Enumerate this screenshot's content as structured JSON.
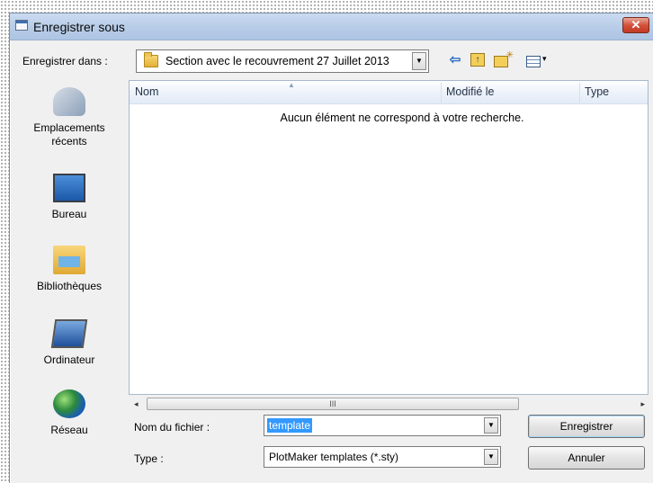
{
  "window": {
    "title": "Enregistrer sous",
    "close_glyph": "✕"
  },
  "toolbar": {
    "save_in_label": "Enregistrer dans :",
    "location": "Section avec le recouvrement 27 Juillet 2013",
    "dropdown_glyph": "▼",
    "back_glyph": "⇦",
    "up_glyph": "↑",
    "view_arrow_glyph": "▾"
  },
  "places": [
    {
      "label": "Emplacements récents",
      "icon": "recent-places-icon"
    },
    {
      "label": "Bureau",
      "icon": "desktop-icon"
    },
    {
      "label": "Bibliothèques",
      "icon": "libraries-icon"
    },
    {
      "label": "Ordinateur",
      "icon": "computer-icon"
    },
    {
      "label": "Réseau",
      "icon": "network-icon"
    }
  ],
  "file_list": {
    "columns": [
      "Nom",
      "Modifié le",
      "Type"
    ],
    "sort_indicator": "▲",
    "empty_message": "Aucun élément ne correspond à votre recherche."
  },
  "scrollbar": {
    "left_glyph": "◂",
    "right_glyph": "▸",
    "thumb_grip": "III"
  },
  "form": {
    "filename_label": "Nom du fichier :",
    "filename_value": "template",
    "type_label": "Type :",
    "type_value": "PlotMaker templates (*.sty)"
  },
  "buttons": {
    "save": "Enregistrer",
    "cancel": "Annuler"
  }
}
